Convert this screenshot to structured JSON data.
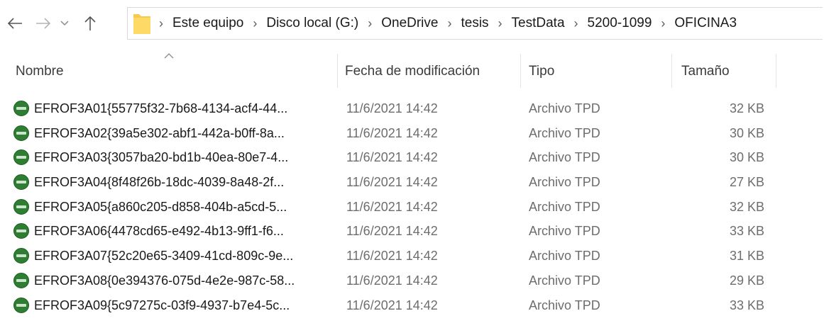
{
  "nav": {
    "back_icon": "arrow-left-icon",
    "forward_icon": "arrow-right-icon",
    "recent_icon": "chevron-down-icon",
    "up_icon": "arrow-up-icon"
  },
  "address": {
    "folder_icon": "folder-icon",
    "separator": "›",
    "crumbs": [
      "Este equipo",
      "Disco local (G:)",
      "OneDrive",
      "tesis",
      "TestData",
      "5200-1099",
      "OFICINA3"
    ]
  },
  "columns": {
    "name": "Nombre",
    "date": "Fecha de modificación",
    "type": "Tipo",
    "size": "Tamaño",
    "sort_indicator": "sort-ascending-icon"
  },
  "colors": {
    "icon_green": "#2e7d32",
    "text_primary": "#1a1a1a",
    "text_secondary": "#6d6d6d",
    "folder_yellow": "#ffd966"
  },
  "files": [
    {
      "name": "EFROF3A01{55775f32-7b68-4134-acf4-44...",
      "date": "11/6/2021 14:42",
      "type": "Archivo TPD",
      "size": "32 KB",
      "icon": "tpd-file-icon"
    },
    {
      "name": "EFROF3A02{39a5e302-abf1-442a-b0ff-8a...",
      "date": "11/6/2021 14:42",
      "type": "Archivo TPD",
      "size": "30 KB",
      "icon": "tpd-file-icon"
    },
    {
      "name": "EFROF3A03{3057ba20-bd1b-40ea-80e7-4...",
      "date": "11/6/2021 14:42",
      "type": "Archivo TPD",
      "size": "30 KB",
      "icon": "tpd-file-icon"
    },
    {
      "name": "EFROF3A04{8f48f26b-18dc-4039-8a48-2f...",
      "date": "11/6/2021 14:42",
      "type": "Archivo TPD",
      "size": "27 KB",
      "icon": "tpd-file-icon"
    },
    {
      "name": "EFROF3A05{a860c205-d858-404b-a5cd-5...",
      "date": "11/6/2021 14:42",
      "type": "Archivo TPD",
      "size": "32 KB",
      "icon": "tpd-file-icon"
    },
    {
      "name": "EFROF3A06{4478cd65-e492-4b13-9ff1-f6...",
      "date": "11/6/2021 14:42",
      "type": "Archivo TPD",
      "size": "33 KB",
      "icon": "tpd-file-icon"
    },
    {
      "name": "EFROF3A07{52c20e65-3409-41cd-809c-9e...",
      "date": "11/6/2021 14:42",
      "type": "Archivo TPD",
      "size": "31 KB",
      "icon": "tpd-file-icon"
    },
    {
      "name": "EFROF3A08{0e394376-075d-4e2e-987c-58...",
      "date": "11/6/2021 14:42",
      "type": "Archivo TPD",
      "size": "29 KB",
      "icon": "tpd-file-icon"
    },
    {
      "name": "EFROF3A09{5c97275c-03f9-4937-b7e4-5c...",
      "date": "11/6/2021 14:42",
      "type": "Archivo TPD",
      "size": "33 KB",
      "icon": "tpd-file-icon"
    }
  ]
}
